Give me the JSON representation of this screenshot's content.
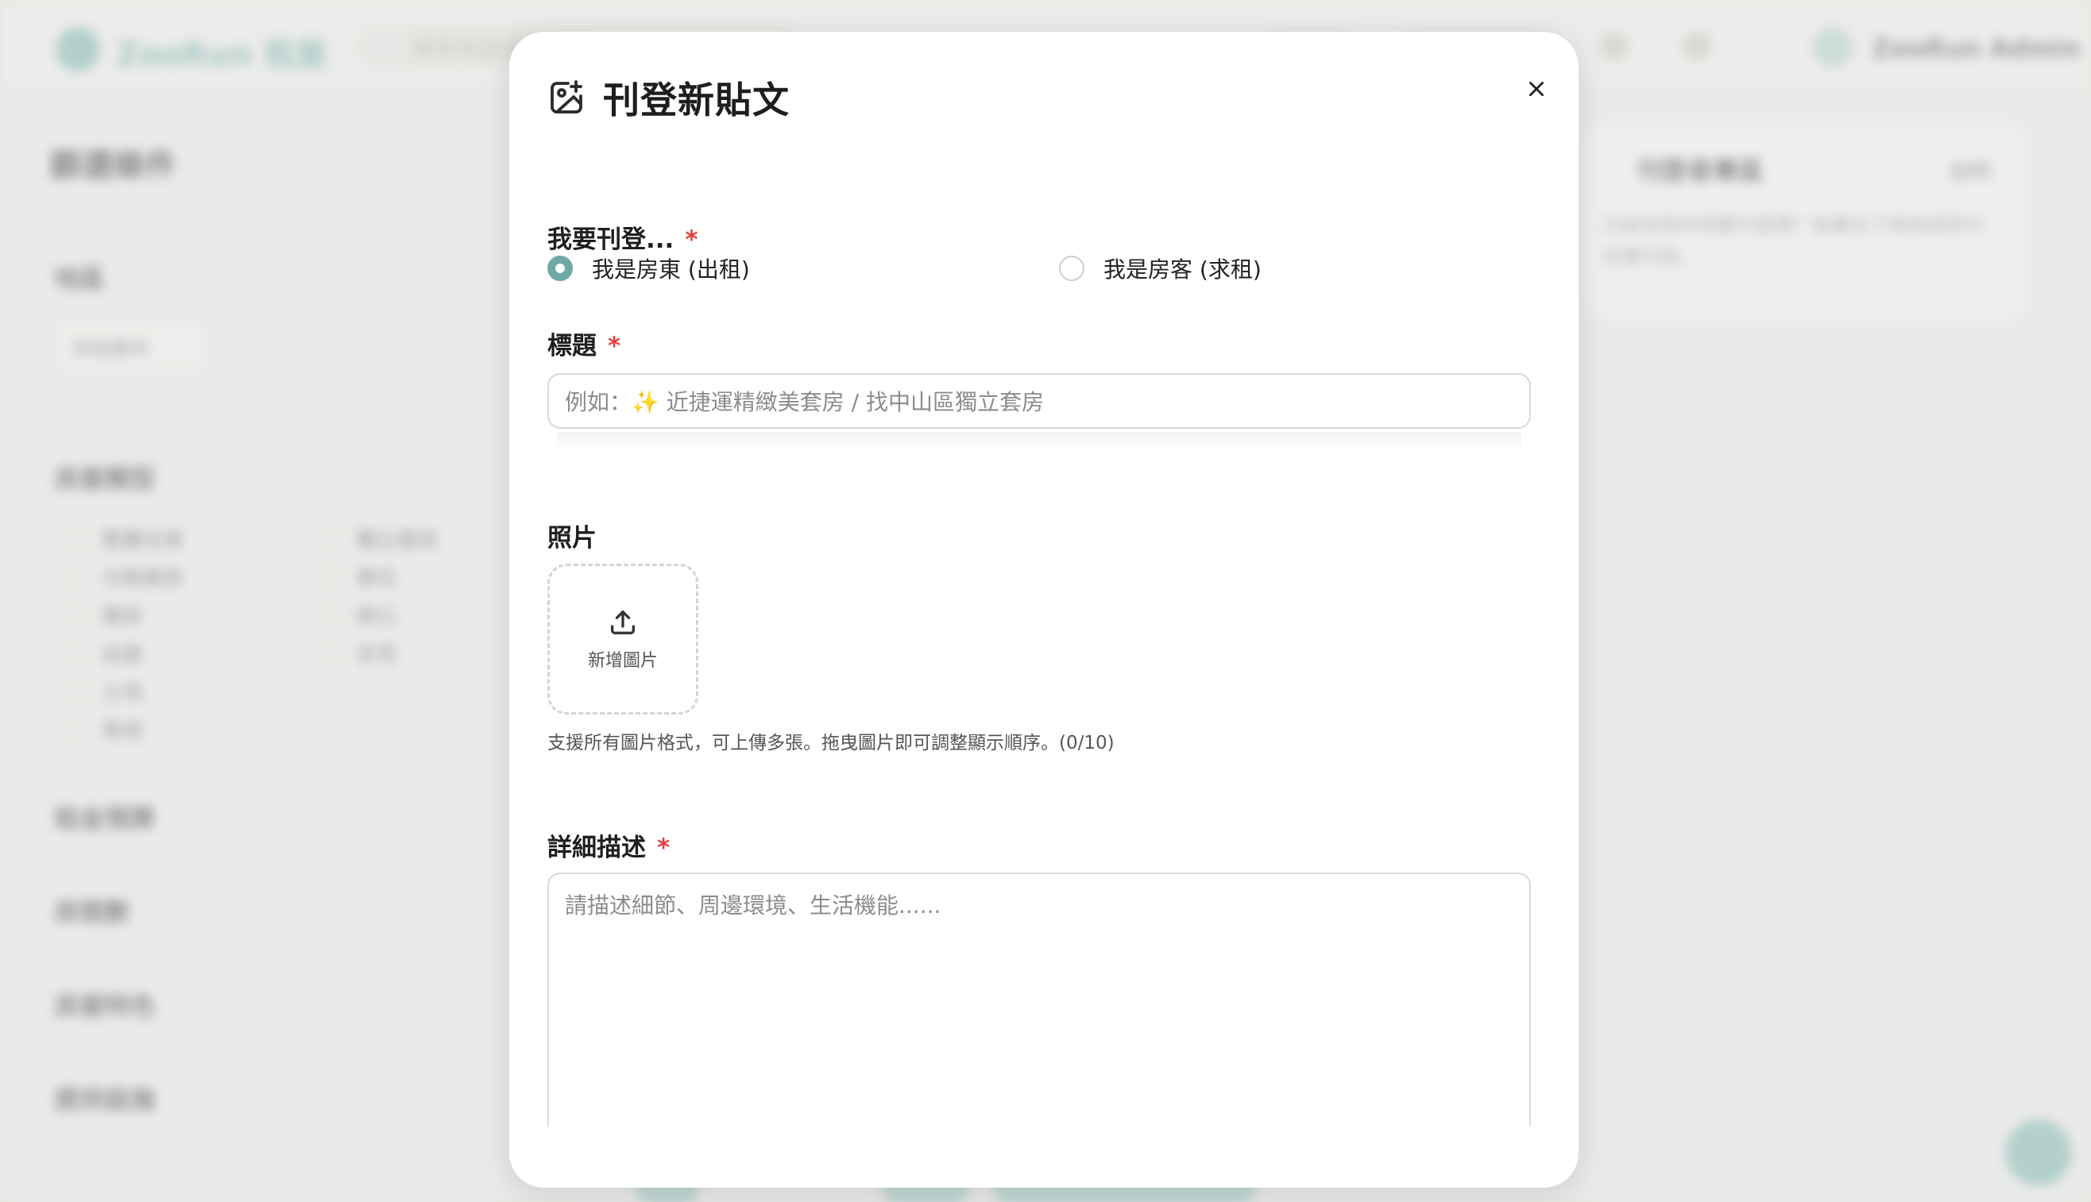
{
  "background": {
    "brand": "ZooRun 租屋",
    "search_placeholder": "搜尋地區或關鍵字",
    "user_name": "ZooRun Admin",
    "sidebar_title": "篩選條件",
    "sections": [
      "地區",
      "房屋類型",
      "租金預算",
      "房間數",
      "房屋特色",
      "提供設施"
    ],
    "region_chip": "所有縣市",
    "checkbox_items": [
      "整層住家",
      "獨立套房",
      "分租套房",
      "雅房",
      "車位",
      "其他",
      "店面",
      "辦公",
      "土地",
      "住宅"
    ],
    "card_title": "刊登者專區",
    "card_badge": "說明",
    "card_text": "已經有物件想要刊登嗎？點擊右下角按鈕即可免費刊登。"
  },
  "modal": {
    "title": "刊登新貼文",
    "close_label": "×",
    "type_label": "我要刊登...",
    "required_mark": "*",
    "options": [
      {
        "label": "我是房東 (出租)",
        "checked": true
      },
      {
        "label": "我是房客 (求租)",
        "checked": false
      }
    ],
    "title_label": "標題",
    "title_placeholder": "例如：✨ 近捷運精緻美套房 / 找中山區獨立套房",
    "photo_label": "照片",
    "upload_label": "新增圖片",
    "photo_help": "支援所有圖片格式，可上傳多張。拖曳圖片即可調整顯示順序。(0/10)",
    "desc_label": "詳細描述",
    "desc_placeholder": "請描述細節、周邊環境、生活機能......"
  },
  "colors": {
    "accent": "#6fa9a4",
    "required": "#e44040"
  }
}
